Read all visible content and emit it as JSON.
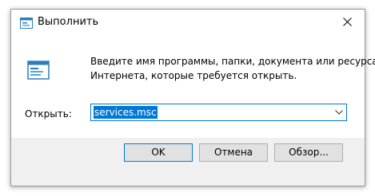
{
  "window": {
    "title": "Выполнить",
    "icon": "run-icon",
    "close_icon": "close-icon"
  },
  "content": {
    "description_line1": "Введите имя программы, папки, документа или ресурса",
    "description_line2": "Интернета, которые требуется открыть.",
    "open_label": "Открыть:",
    "open_value": "services.msc",
    "dropdown_icon": "chevron-down-icon"
  },
  "buttons": {
    "ok": "OK",
    "cancel": "Отмена",
    "browse": "Обзор..."
  },
  "colors": {
    "accent": "#0078d7",
    "dialog_background": "#f0f0f0",
    "button_face": "#e1e1e1"
  }
}
